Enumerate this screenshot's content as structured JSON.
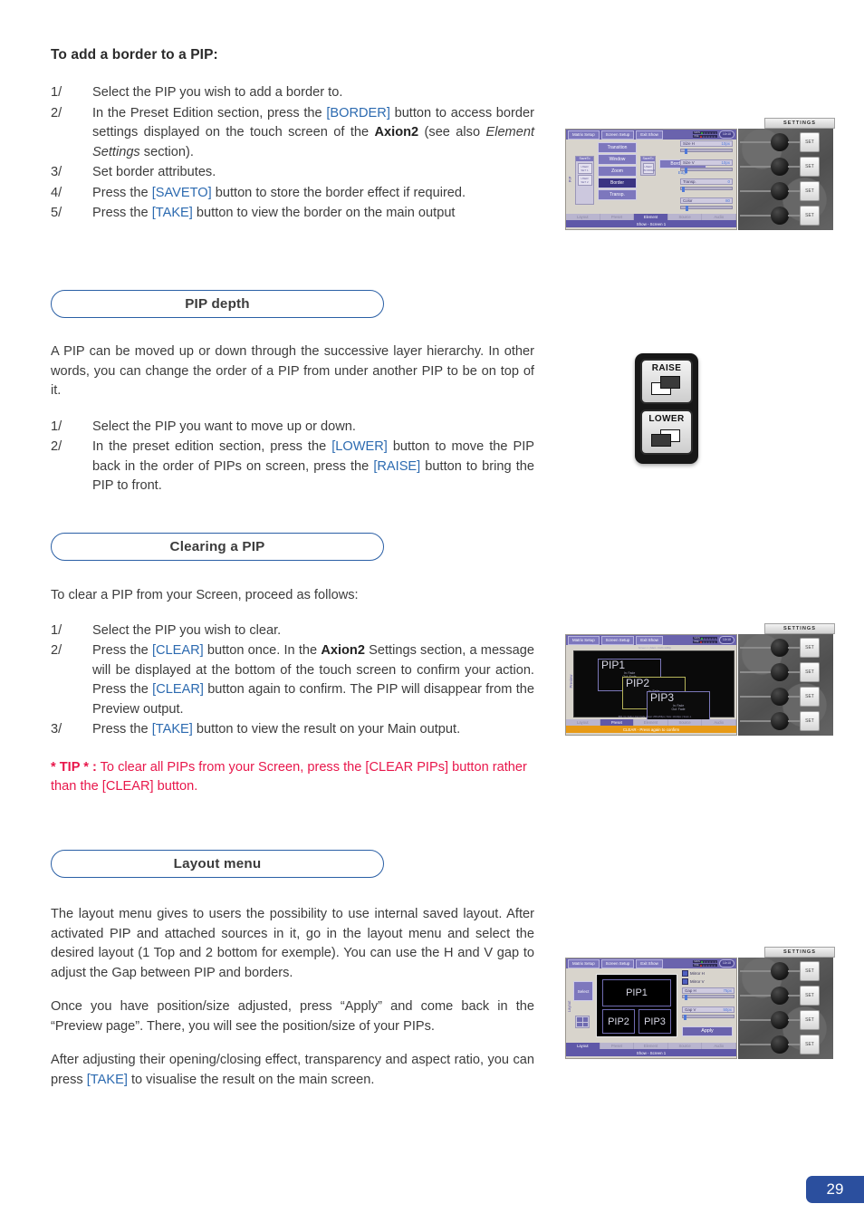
{
  "page": {
    "number": "29"
  },
  "sections": {
    "border": {
      "title": "To add a border to a PIP:",
      "steps": [
        {
          "num": "1/",
          "parts": [
            {
              "t": "Select the PIP you wish to add a border to."
            }
          ]
        },
        {
          "num": "2/",
          "parts": [
            {
              "t": "In the Preset Edition section, press the "
            },
            {
              "t": "[BORDER]",
              "k": "btn"
            },
            {
              "t": " button to access border settings displayed on the touch screen of the "
            },
            {
              "t": "Axion2",
              "k": "bold"
            },
            {
              "t": " (see also "
            },
            {
              "t": "Element Settings",
              "k": "ital"
            },
            {
              "t": " section)."
            }
          ]
        },
        {
          "num": "3/",
          "parts": [
            {
              "t": "Set border attributes."
            }
          ]
        },
        {
          "num": "4/",
          "parts": [
            {
              "t": "Press the "
            },
            {
              "t": "[SAVETO]",
              "k": "btn"
            },
            {
              "t": " button to store the border effect if required."
            }
          ]
        },
        {
          "num": "5/",
          "parts": [
            {
              "t": "Press the "
            },
            {
              "t": "[TAKE]",
              "k": "btn"
            },
            {
              "t": " button to view the border on the main output"
            }
          ]
        }
      ]
    },
    "pip_depth": {
      "heading": "PIP depth",
      "intro": "A PIP can be moved up or down through the successive layer hierarchy. In other words, you can change the order of a PIP from under another PIP to be on top of it.",
      "steps": [
        {
          "num": "1/",
          "parts": [
            {
              "t": "Select the PIP you want to move up or down."
            }
          ]
        },
        {
          "num": "2/",
          "parts": [
            {
              "t": "In the preset edition section, press the "
            },
            {
              "t": "[LOWER]",
              "k": "btn"
            },
            {
              "t": " button to move the PIP back in the order of PIPs on screen, press the "
            },
            {
              "t": "[RAISE]",
              "k": "btn"
            },
            {
              "t": " button to bring the PIP to front."
            }
          ]
        }
      ]
    },
    "clearing": {
      "heading": "Clearing a PIP",
      "intro": "To clear a PIP from your Screen, proceed as follows:",
      "steps": [
        {
          "num": "1/",
          "parts": [
            {
              "t": "Select the PIP you wish to clear."
            }
          ]
        },
        {
          "num": "2/",
          "parts": [
            {
              "t": "Press the "
            },
            {
              "t": "[CLEAR]",
              "k": "btn"
            },
            {
              "t": " button once. In the "
            },
            {
              "t": "Axion2",
              "k": "bold"
            },
            {
              "t": " Settings section, a message will be displayed at the bottom of the touch screen to confirm your action. Press the "
            },
            {
              "t": "[CLEAR]",
              "k": "btn"
            },
            {
              "t": " button again to confirm. The PIP will disappear from the Preview output."
            }
          ]
        },
        {
          "num": "3/",
          "parts": [
            {
              "t": "Press the "
            },
            {
              "t": "[TAKE]",
              "k": "btn"
            },
            {
              "t": " button to view the result on your Main output."
            }
          ]
        }
      ],
      "tip_label": "* TIP * :",
      "tip_text": " To clear all PIPs from your Screen, press the [CLEAR PIPs] button rather than the [CLEAR] button."
    },
    "layout_menu": {
      "heading": "Layout menu",
      "p1": "The layout menu gives to users the possibility to use internal saved layout. After activated PIP and attached sources in it, go in the layout menu and select the desired layout (1 Top and 2 bottom for exemple). You can use the H and V gap to adjust the Gap between PIP and borders.",
      "p2": "Once you have position/size adjusted, press “Apply” and come back in the “Preview page”. There, you will see the position/size of your PIPs.",
      "p3_parts": [
        {
          "t": "After adjusting their opening/closing effect, transparency and aspect ratio, you can press "
        },
        {
          "t": "[TAKE]",
          "k": "btn"
        },
        {
          "t": " to visualise the result on the main screen."
        }
      ]
    }
  },
  "figures": {
    "settings_tag": "SETTINGS",
    "set_button": "SET",
    "common": {
      "top_tabs": [
        "Matrix Setup",
        "Screen Setup",
        "Exit Show"
      ],
      "led_labels": [
        "MAIN",
        "PRE"
      ],
      "clock": "11h18",
      "bottom_tabs": [
        "Layout",
        "Preset",
        "Element",
        "Source",
        "Audio"
      ],
      "status": "Show - Screen 1"
    },
    "fig_border": {
      "active_bottom_tab": "Element",
      "side_label": "PIP",
      "save_to_label": "SaveTo",
      "save_cells": [
        "USER SET 1",
        "USER SET 2"
      ],
      "menu_buttons": [
        "Transition",
        "Window",
        "Zoom",
        "Border",
        "Transp."
      ],
      "selected_menu_button": "Border",
      "save_to_2_label": "SaveTo",
      "save_to_2_cell": "USER BORDER",
      "border_type_label": "Border Type",
      "border_type_value": "Edge",
      "sliders": [
        {
          "label": "Size H",
          "value": "10px",
          "pos": 10
        },
        {
          "label": "Size V",
          "value": "10px",
          "pos": 10
        },
        {
          "label": "Transp.",
          "value": "0",
          "pos": 2
        },
        {
          "label": "Color",
          "value": "80",
          "pos": 12
        }
      ]
    },
    "fig_clear": {
      "active_bottom_tab": "Preset",
      "side_label": "Preview",
      "caption": "Screen 1 | Main: 1920x1080p",
      "footer_info": "800 | In: Fade | Out: Fade | Dest: 256x256px | Size: 10x10px | Scan: o",
      "status_message": "CLEAR - Press again to confirm",
      "pips": [
        {
          "name": "PIP1",
          "in": "In: Fade",
          "out": "Out: Fade"
        },
        {
          "name": "PIP2",
          "in": "In: Fade",
          "out": "Out: Fade"
        },
        {
          "name": "PIP3",
          "in": "In: Fade",
          "out": "Out: Fade"
        }
      ]
    },
    "fig_layout": {
      "active_bottom_tab": "Layout",
      "side_label": "Layout",
      "select_label": "Select",
      "pips": [
        "PIP1",
        "PIP2",
        "PIP3"
      ],
      "checkboxes": [
        "Mirror H",
        "Mirror V"
      ],
      "sliders": [
        {
          "label": "Gap H",
          "value": "75px",
          "pos": 6
        },
        {
          "label": "Gap V",
          "value": "50px",
          "pos": 4
        }
      ],
      "apply_label": "Apply"
    },
    "raise_lower": {
      "raise_label": "RAISE",
      "lower_label": "LOWER"
    }
  }
}
